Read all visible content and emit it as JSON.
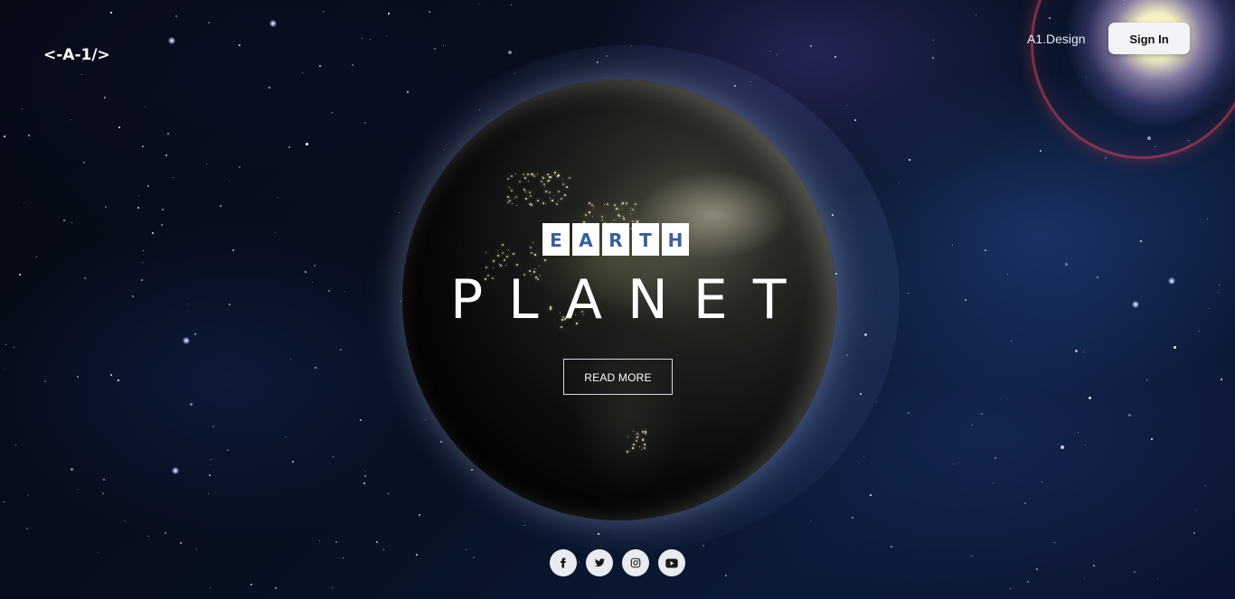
{
  "header": {
    "logo_text": "<-A-1/>",
    "nav_link": "A1.Design",
    "signin_label": "Sign In"
  },
  "hero": {
    "kicker_letters": [
      "E",
      "A",
      "R",
      "T",
      "H"
    ],
    "title": "PLANET",
    "cta_label": "READ MORE"
  },
  "social": [
    {
      "icon": "facebook-icon"
    },
    {
      "icon": "twitter-icon"
    },
    {
      "icon": "instagram-icon"
    },
    {
      "icon": "youtube-icon"
    }
  ],
  "colors": {
    "letter_tile_bg": "#ffffff",
    "letter_tile_text": "#3a5f9a",
    "signin_bg": "#f2f3f6",
    "social_bg": "#e9ebf1"
  }
}
